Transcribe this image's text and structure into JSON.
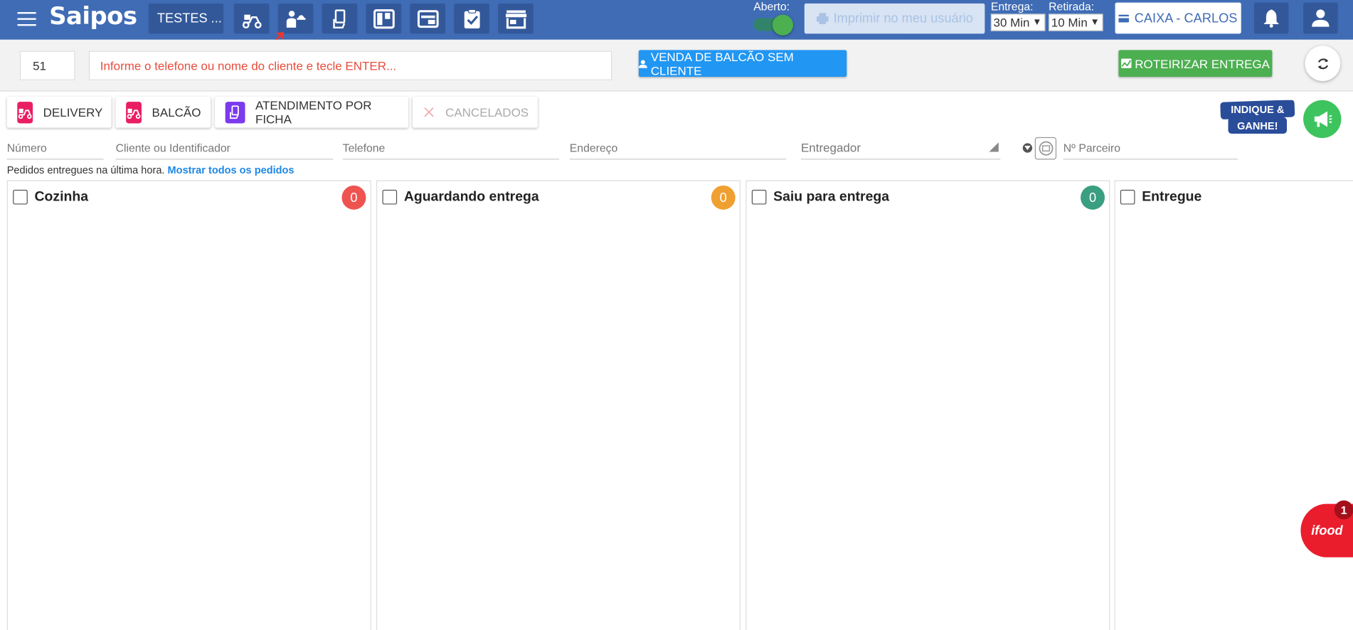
{
  "header": {
    "logo": "Saipos",
    "store_name": "TESTES ...",
    "aberto_label": "Aberto:",
    "print_label": "Imprimir no meu usuário",
    "entrega_label": "Entrega:",
    "entrega_value": "30 Min",
    "retirada_label": "Retirada:",
    "retirada_value": "10 Min",
    "caixa_label": "CAIXA - CARLOS",
    "nav_icons": [
      "delivery-scooter-icon",
      "waiter-icon",
      "ticket-hand-icon",
      "kanban-icon",
      "panel-icon",
      "clipboard-check-icon",
      "store-icon"
    ]
  },
  "search": {
    "number_value": "51",
    "phone_placeholder": "Informe o telefone ou nome do cliente e tecle ENTER...",
    "venda_button": "VENDA DE BALCÃO SEM CLIENTE",
    "roteirizar_button": "ROTEIRIZAR ENTREGA"
  },
  "tabs": [
    {
      "label": "DELIVERY"
    },
    {
      "label": "BALCÃO"
    },
    {
      "label": "ATENDIMENTO POR FICHA"
    },
    {
      "label": "CANCELADOS"
    }
  ],
  "promo": {
    "line1": "INDIQUE &",
    "line2": "GANHE!"
  },
  "filters": {
    "numero": "Número",
    "cliente": "Cliente ou Identificador",
    "telefone": "Telefone",
    "endereco": "Endereço",
    "entregador": "Entregador",
    "parceiro": "Nº Parceiro"
  },
  "info": {
    "text": "Pedidos entregues na última hora.",
    "link": "Mostrar todos os pedidos"
  },
  "columns": [
    {
      "title": "Cozinha",
      "count": "0",
      "color": "#ef5350"
    },
    {
      "title": "Aguardando entrega",
      "count": "0",
      "color": "#f0a030"
    },
    {
      "title": "Saiu para entrega",
      "count": "0",
      "color": "#3a9e80"
    },
    {
      "title": "Entregue"
    }
  ],
  "ifood": {
    "label": "ifood",
    "count": "1"
  },
  "colors": {
    "topbar": "#3f6cb5",
    "accent_blue": "#2196f3",
    "accent_green": "#4caf50"
  }
}
